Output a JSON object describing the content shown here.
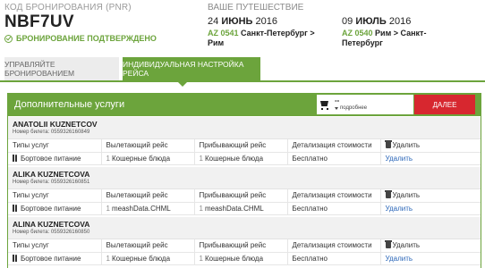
{
  "booking": {
    "pnr_label": "КОД БРОНИРОВАНИЯ (PNR)",
    "pnr_code": "NBF7UV",
    "status": "БРОНИРОВАНИЕ ПОДТВЕРЖДЕНО"
  },
  "trip": {
    "label": "ВАШЕ ПУТЕШЕСТВИЕ",
    "segments": [
      {
        "date_day": "24",
        "date_month": "ИЮНЬ",
        "date_year": "2016",
        "flight": "AZ 0541",
        "route": "Санкт-Петербург > Рим"
      },
      {
        "date_day": "09",
        "date_month": "ИЮЛЬ",
        "date_year": "2016",
        "flight": "AZ 0540",
        "route": "Рим > Санкт-Петербург"
      }
    ]
  },
  "tabs": {
    "manage": "УПРАВЛЯЙТЕ БРОНИРОВАНИЕМ",
    "customize": "ИНДИВИДУАЛЬНАЯ НАСТРОЙКА РЕЙСА"
  },
  "panel": {
    "title": "Дополнительные услуги",
    "cart_price": "--",
    "cart_detail": "подробнее",
    "next_label": "ДАЛЕЕ"
  },
  "columns": {
    "service_type": "Типы услуг",
    "outbound": "Вылетающий рейс",
    "inbound": "Прибывающий рейс",
    "cost_detail": "Детализация стоимости",
    "delete": "Удалить"
  },
  "passengers": [
    {
      "name": "ANATOLII KUZNETCOV",
      "ticket": "Номер билета: 0559326160849",
      "service": "Бортовое питание",
      "out_qty": "1",
      "out_value": "Кошерные блюда",
      "in_qty": "1",
      "in_value": "Кошерные блюда",
      "cost": "Бесплатно",
      "delete": "Удалить"
    },
    {
      "name": "ALIKA KUZNETCOVA",
      "ticket": "Номер билета: 0559326160851",
      "service": "Бортовое питание",
      "out_qty": "1",
      "out_value": "meashData.CHML",
      "in_qty": "1",
      "in_value": "meashData.CHML",
      "cost": "Бесплатно",
      "delete": "Удалить"
    },
    {
      "name": "ALINA KUZNETCOVA",
      "ticket": "Номер билета: 0559326160850",
      "service": "Бортовое питание",
      "out_qty": "1",
      "out_value": "Кошерные блюда",
      "in_qty": "1",
      "in_value": "Кошерные блюда",
      "cost": "Бесплатно",
      "delete": "Удалить"
    }
  ]
}
